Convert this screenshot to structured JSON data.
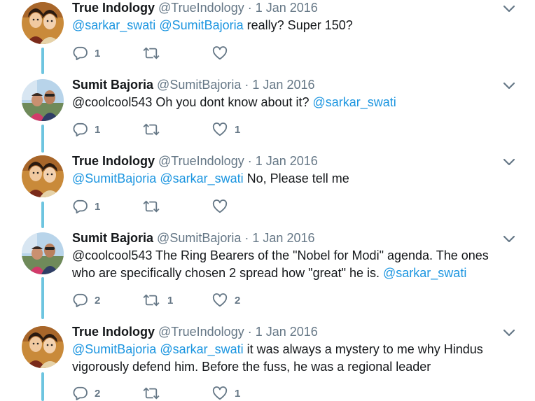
{
  "tweets": [
    {
      "name": "True Indology",
      "handle": "@TrueIndology",
      "dot": "·",
      "date": "1 Jan 2016",
      "segments": [
        {
          "text": "@sarkar_swati",
          "mention": true
        },
        {
          "text": " ",
          "mention": false
        },
        {
          "text": "@SumitBajoria",
          "mention": true
        },
        {
          "text": " really? Super 150?",
          "mention": false
        }
      ],
      "replies": "1",
      "retweets": "",
      "likes": ""
    },
    {
      "name": "Sumit Bajoria",
      "handle": "@SumitBajoria",
      "dot": "·",
      "date": "1 Jan 2016",
      "segments": [
        {
          "text": "@coolcool543 Oh you dont know about it? ",
          "mention": false
        },
        {
          "text": "@sarkar_swati",
          "mention": true
        }
      ],
      "replies": "1",
      "retweets": "",
      "likes": "1"
    },
    {
      "name": "True Indology",
      "handle": "@TrueIndology",
      "dot": "·",
      "date": "1 Jan 2016",
      "segments": [
        {
          "text": "@SumitBajoria",
          "mention": true
        },
        {
          "text": " ",
          "mention": false
        },
        {
          "text": "@sarkar_swati",
          "mention": true
        },
        {
          "text": " No, Please tell me",
          "mention": false
        }
      ],
      "replies": "1",
      "retweets": "",
      "likes": ""
    },
    {
      "name": "Sumit Bajoria",
      "handle": "@SumitBajoria",
      "dot": "·",
      "date": "1 Jan 2016",
      "segments": [
        {
          "text": "@coolcool543 The Ring Bearers of the \"Nobel for Modi\" agenda. The ones who are specifically chosen 2 spread how \"great\" he is. ",
          "mention": false
        },
        {
          "text": "@sarkar_swati",
          "mention": true
        }
      ],
      "replies": "2",
      "retweets": "1",
      "likes": "2"
    },
    {
      "name": "True Indology",
      "handle": "@TrueIndology",
      "dot": "·",
      "date": "1 Jan 2016",
      "segments": [
        {
          "text": "@SumitBajoria",
          "mention": true
        },
        {
          "text": " ",
          "mention": false
        },
        {
          "text": "@sarkar_swati",
          "mention": true
        },
        {
          "text": " it was always a mystery to me why Hindus vigorously defend him. Before the fuss, he was a regional leader",
          "mention": false
        }
      ],
      "replies": "2",
      "retweets": "",
      "likes": "1"
    }
  ],
  "icons": {
    "reply": "reply-icon",
    "retweet": "retweet-icon",
    "like": "heart-icon",
    "more": "chevron-down-icon"
  },
  "colors": {
    "thread_line": "#6ec5e0",
    "mention": "#1b95e0",
    "secondary_text": "#657786"
  }
}
